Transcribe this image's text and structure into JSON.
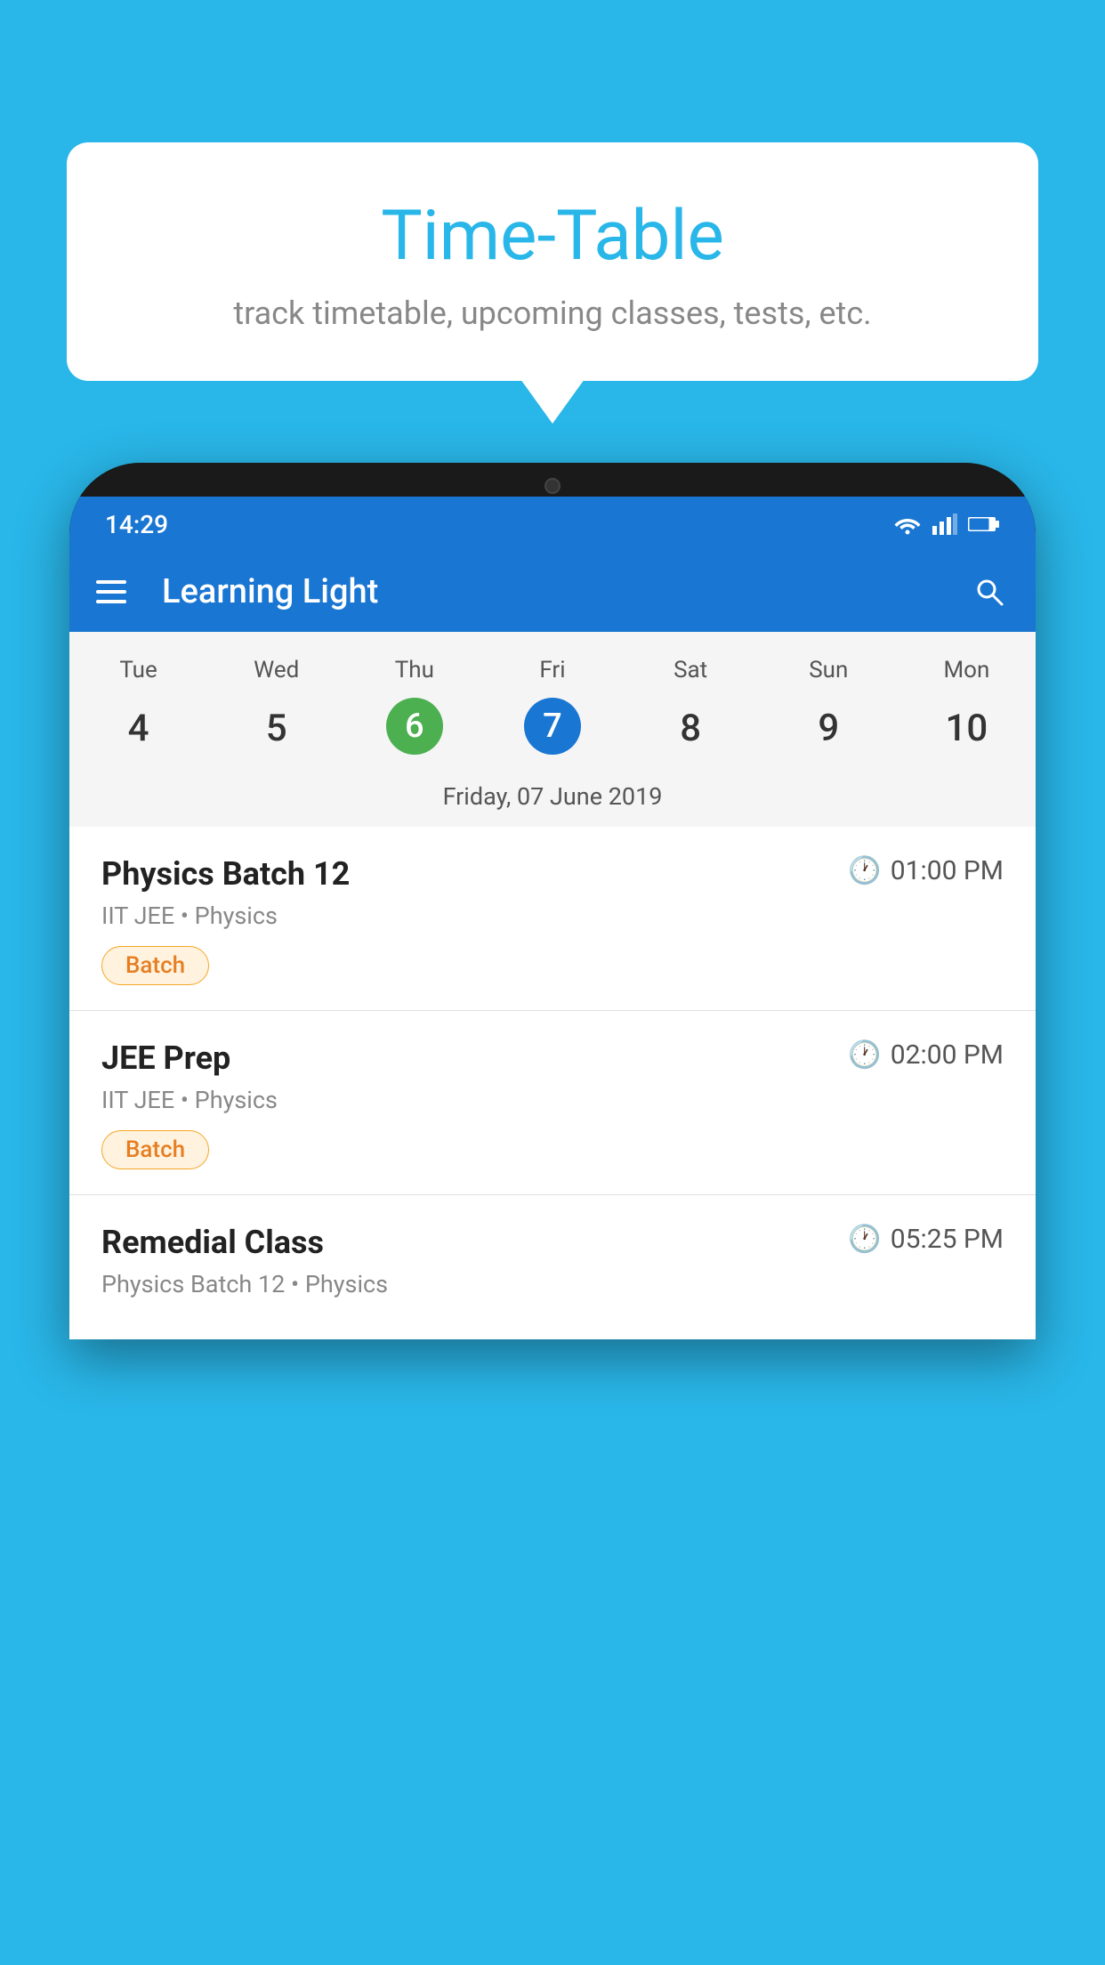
{
  "background_color": "#29b6e8",
  "speech_bubble": {
    "title": "Time-Table",
    "subtitle": "track timetable, upcoming classes, tests, etc."
  },
  "phone": {
    "status_bar": {
      "time": "14:29"
    },
    "app_header": {
      "title": "Learning Light"
    },
    "calendar": {
      "days": [
        {
          "label": "Tue",
          "number": "4"
        },
        {
          "label": "Wed",
          "number": "5"
        },
        {
          "label": "Thu",
          "number": "6",
          "state": "today"
        },
        {
          "label": "Fri",
          "number": "7",
          "state": "selected"
        },
        {
          "label": "Sat",
          "number": "8"
        },
        {
          "label": "Sun",
          "number": "9"
        },
        {
          "label": "Mon",
          "number": "10"
        }
      ],
      "selected_date_label": "Friday, 07 June 2019"
    },
    "schedule": [
      {
        "title": "Physics Batch 12",
        "time": "01:00 PM",
        "subtitle": "IIT JEE • Physics",
        "badge": "Batch"
      },
      {
        "title": "JEE Prep",
        "time": "02:00 PM",
        "subtitle": "IIT JEE • Physics",
        "badge": "Batch"
      },
      {
        "title": "Remedial Class",
        "time": "05:25 PM",
        "subtitle": "Physics Batch 12 • Physics",
        "badge": null
      }
    ]
  }
}
